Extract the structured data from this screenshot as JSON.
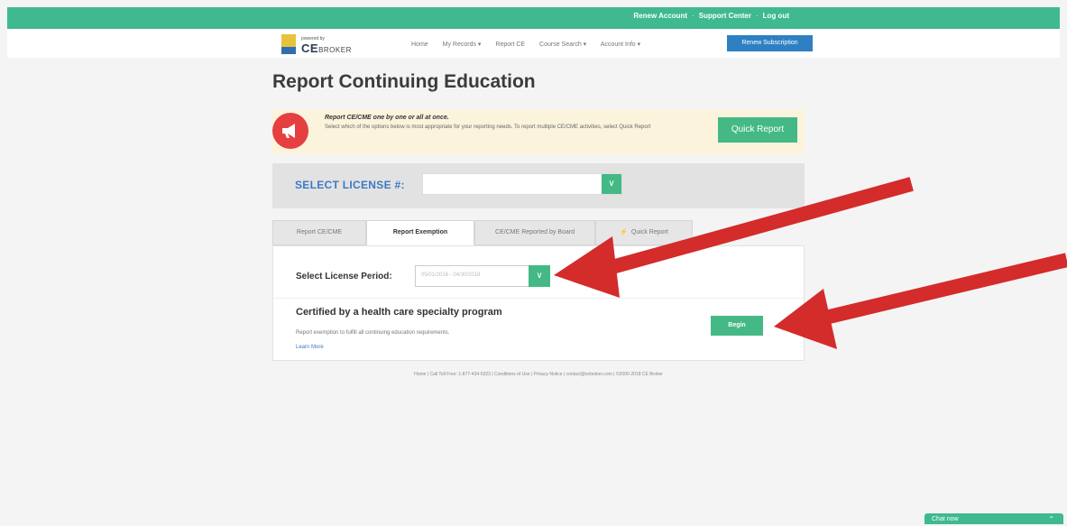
{
  "topbar": {
    "links": [
      "Renew Account",
      "Support Center",
      "Log out"
    ],
    "color": "#3fb98f"
  },
  "nav": {
    "logo_powered": "powered by",
    "logo_brand": "CE",
    "logo_brand_suffix": "BROKER",
    "items": [
      "Home",
      "My Records ▾",
      "Report CE",
      "Course Search ▾",
      "Account Info ▾"
    ],
    "renew_label": "Renew Subscription"
  },
  "page": {
    "title": "Report Continuing Education"
  },
  "alert": {
    "heading": "Report CE/CME one by one or all at once.",
    "body": "Select which of the options below is most appropriate for your reporting needs. To report multiple CE/CME activities, select Quick Report",
    "quick_report_label": "Quick Report"
  },
  "license": {
    "label": "SELECT LICENSE #:",
    "value": ""
  },
  "tabs": [
    {
      "label": "Report CE/CME"
    },
    {
      "label": "Report Exemption"
    },
    {
      "label": "CE/CME Reported by Board"
    },
    {
      "label": "Quick Report"
    }
  ],
  "exemption": {
    "period_label": "Select License Period:",
    "period_value": "05/01/2016 - 04/30/2018",
    "cert_title": "Certified by a health care specialty program",
    "cert_desc": "Report exemption to fulfill all continuing education requirements.",
    "learn_more": "Learn More",
    "begin_label": "Begin"
  },
  "footer": {
    "text": "Home | Call Toll Free: 1-877-434-6323 | Conditions of Use | Privacy Notice | contact@cebroker.com | ©2000-2018 CE Broker"
  },
  "chat": {
    "label": "Chat now"
  },
  "colors": {
    "accent_green": "#44b985",
    "brand_blue": "#2e80c3",
    "alert_red": "#e53f3f",
    "arrow_red": "#d42b2b"
  }
}
